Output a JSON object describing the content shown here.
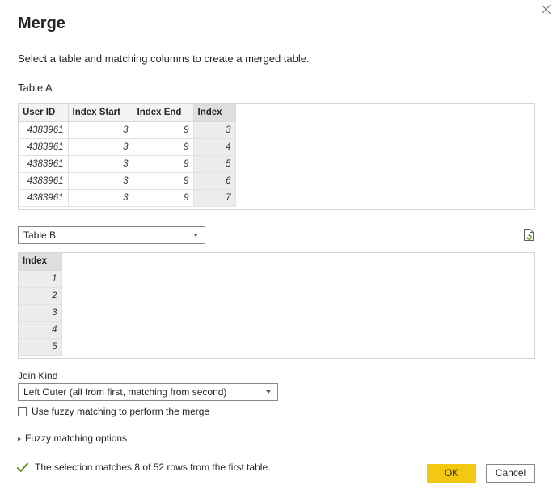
{
  "dialog": {
    "title": "Merge",
    "subtitle": "Select a table and matching columns to create a merged table."
  },
  "table_a": {
    "label": "Table A",
    "columns": [
      "User ID",
      "Index Start",
      "Index End",
      "Index"
    ],
    "rows": [
      [
        "4383961",
        "3",
        "9",
        "3"
      ],
      [
        "4383961",
        "3",
        "9",
        "4"
      ],
      [
        "4383961",
        "3",
        "9",
        "5"
      ],
      [
        "4383961",
        "3",
        "9",
        "6"
      ],
      [
        "4383961",
        "3",
        "9",
        "7"
      ]
    ],
    "selected_column": "Index"
  },
  "table_b": {
    "selected": "Table B",
    "columns": [
      "Index"
    ],
    "rows": [
      [
        "1"
      ],
      [
        "2"
      ],
      [
        "3"
      ],
      [
        "4"
      ],
      [
        "5"
      ]
    ],
    "selected_column": "Index"
  },
  "join": {
    "label": "Join Kind",
    "selected": "Left Outer (all from first, matching from second)"
  },
  "fuzzy": {
    "checkbox_label": "Use fuzzy matching to perform the merge",
    "checked": false,
    "options_label": "Fuzzy matching options"
  },
  "status": {
    "text": "The selection matches 8 of 52 rows from the first table.",
    "color": "#498205"
  },
  "buttons": {
    "ok": "OK",
    "cancel": "Cancel"
  },
  "colors": {
    "accent": "#f2c811"
  }
}
